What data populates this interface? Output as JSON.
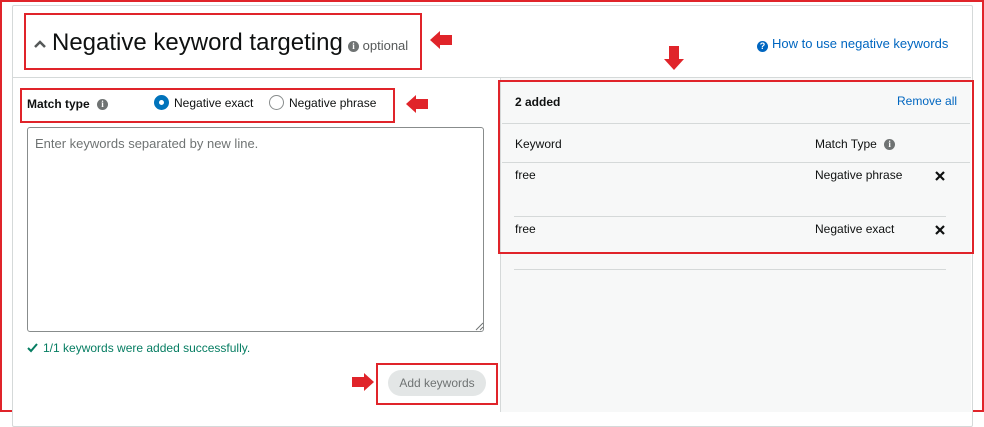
{
  "header": {
    "title": "Negative keyword targeting",
    "optional": "optional",
    "help_link": "How to use negative keywords"
  },
  "match_type": {
    "label": "Match type",
    "options": [
      {
        "label": "Negative exact",
        "selected": true
      },
      {
        "label": "Negative phrase",
        "selected": false
      }
    ]
  },
  "keywords_input": {
    "placeholder": "Enter keywords separated by new line.",
    "value": ""
  },
  "success_message": "1/1 keywords were added successfully.",
  "add_button_label": "Add keywords",
  "added_panel": {
    "count_label": "2 added",
    "remove_all": "Remove all",
    "columns": {
      "keyword": "Keyword",
      "match_type": "Match Type"
    },
    "rows": [
      {
        "keyword": "free",
        "match_type": "Negative phrase"
      },
      {
        "keyword": "free",
        "match_type": "Negative exact"
      }
    ]
  },
  "colors": {
    "annotation_red": "#e0242a",
    "link_blue": "#0066c0",
    "radio_blue": "#0073bb",
    "success_green": "#067d62"
  },
  "icons": [
    "chevron-up-icon",
    "info-icon",
    "help-icon",
    "check-icon",
    "close-icon",
    "resize-grip-icon",
    "red-arrow-annotation"
  ]
}
